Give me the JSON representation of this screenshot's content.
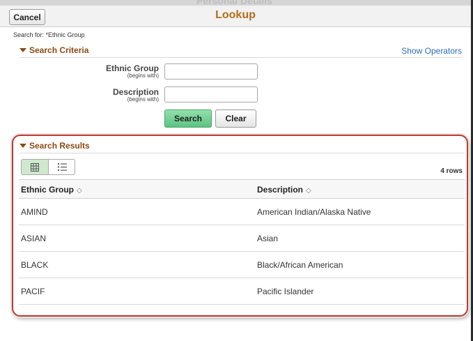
{
  "header": {
    "cancel_label": "Cancel",
    "title": "Lookup",
    "background_title": "Personal Details"
  },
  "search_for": "Search for: *Ethnic Group",
  "criteria": {
    "heading": "Search Criteria",
    "show_operators": "Show Operators",
    "fields": [
      {
        "label": "Ethnic Group",
        "operator": "(begins with)",
        "value": ""
      },
      {
        "label": "Description",
        "operator": "(begins with)",
        "value": ""
      }
    ],
    "search_label": "Search",
    "clear_label": "Clear"
  },
  "results": {
    "heading": "Search Results",
    "row_count": "4 rows",
    "columns": [
      "Ethnic Group",
      "Description"
    ],
    "rows": [
      {
        "code": "AMIND",
        "description": "American Indian/Alaska Native"
      },
      {
        "code": "ASIAN",
        "description": "Asian"
      },
      {
        "code": "BLACK",
        "description": "Black/African American"
      },
      {
        "code": "PACIF",
        "description": "Pacific Islander"
      }
    ]
  },
  "colors": {
    "title": "#b56e18",
    "section_heading": "#8a4b14",
    "link": "#2a6ebb",
    "search_button": "#5cc381",
    "highlight_border": "#c0392b"
  },
  "icons": {
    "section_toggle": "triangle-down-icon",
    "grid_view": "grid-view-icon",
    "list_view": "list-view-icon",
    "sort": "sort-icon"
  }
}
